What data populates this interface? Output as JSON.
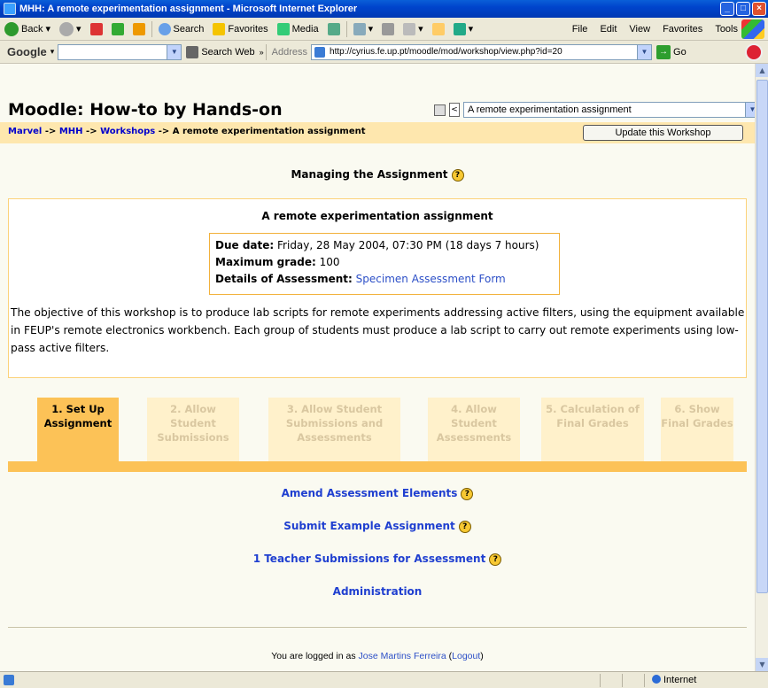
{
  "window": {
    "title": "MHH: A remote experimentation assignment - Microsoft Internet Explorer"
  },
  "toolbar": {
    "back": "Back",
    "search": "Search",
    "favorites": "Favorites",
    "media": "Media",
    "menus": [
      "File",
      "Edit",
      "View",
      "Favorites",
      "Tools"
    ]
  },
  "google_bar": {
    "brand": "Google",
    "search_web": "Search Web"
  },
  "address_bar": {
    "label": "Address",
    "url": "http://cyrius.fe.up.pt/moodle/mod/workshop/view.php?id=20",
    "go": "Go"
  },
  "page": {
    "site_title": "Moodle: How-to by Hands-on",
    "jump_select": "A remote experimentation assignment",
    "breadcrumb": {
      "items": [
        "Marvel",
        "MHH",
        "Workshops"
      ],
      "sep": "->",
      "current": "A remote experimentation assignment"
    },
    "update_button": "Update this Workshop",
    "managing_heading": "Managing the Assignment",
    "help_glyph": "?",
    "assignment": {
      "title": "A remote experimentation assignment",
      "due_label": "Due date:",
      "due_value": "Friday, 28 May 2004, 07:30 PM (18 days 7 hours)",
      "grade_label": "Maximum grade:",
      "grade_value": "100",
      "details_label": "Details of Assessment:",
      "details_link": "Specimen Assessment Form",
      "description": "The objective of this workshop is to produce lab scripts for remote experiments addressing active filters, using the equipment available in FEUP's remote electronics workbench. Each group of students must produce a lab script to carry out remote experiments using low-pass active filters."
    },
    "phases": [
      {
        "label": "1. Set Up Assignment",
        "active": true
      },
      {
        "label": "2. Allow Student Submissions",
        "active": false
      },
      {
        "label": "3. Allow Student Submissions and Assessments",
        "active": false
      },
      {
        "label": "4. Allow Student Assessments",
        "active": false
      },
      {
        "label": "5. Calculation of Final Grades",
        "active": false
      },
      {
        "label": "6. Show Final Grades",
        "active": false
      }
    ],
    "actions": [
      {
        "label": "Amend Assessment Elements",
        "help": true
      },
      {
        "label": "Submit Example Assignment",
        "help": true
      },
      {
        "label": "1 Teacher Submissions for Assessment",
        "help": true
      },
      {
        "label": "Administration",
        "help": false
      }
    ],
    "footer": {
      "prefix": "You are logged in as",
      "user": "Jose Martins Ferreira",
      "logout": "Logout"
    }
  },
  "statusbar": {
    "zone": "Internet"
  },
  "colors": {
    "tab_active": "#fcc257",
    "tab_inactive": "#fff1cb",
    "navbar": "#fee7ae",
    "link": "#1f3fd0"
  }
}
